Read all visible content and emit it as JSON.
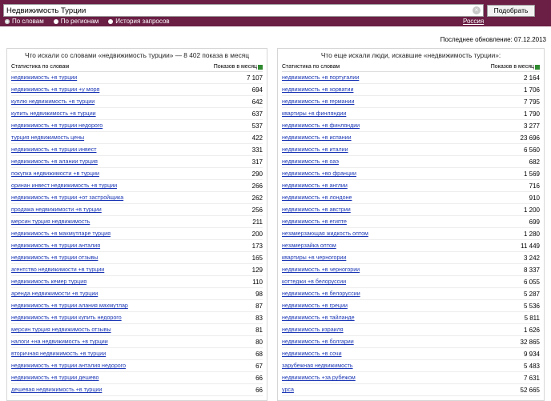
{
  "search": {
    "query": "Недвижимость Турции",
    "submit_label": "Подобрать",
    "clear_icon": "×"
  },
  "tabs": [
    {
      "label": "По словам",
      "active": true
    },
    {
      "label": "По регионам",
      "active": false
    },
    {
      "label": "История запросов",
      "active": false
    }
  ],
  "region": "Россия",
  "last_update": "Последнее обновление: 07.12.2013",
  "left": {
    "title": "Что искали со словами «недвижимость турции» — 8 402 показа в месяц",
    "col_words": "Статистика по словам",
    "col_impressions": "Показов в месяц",
    "rows": [
      {
        "phrase": "недвижимость +в турции",
        "count": "7 107"
      },
      {
        "phrase": "недвижимость +в турции +у моря",
        "count": "694"
      },
      {
        "phrase": "куплю недвижимость +в турции",
        "count": "642"
      },
      {
        "phrase": "купить недвижимость +в турции",
        "count": "637"
      },
      {
        "phrase": "недвижимость +в турции недорого",
        "count": "537"
      },
      {
        "phrase": "турция недвижимость цены",
        "count": "422"
      },
      {
        "phrase": "недвижимость +в турции инвест",
        "count": "331"
      },
      {
        "phrase": "недвижимость +в алании турция",
        "count": "317"
      },
      {
        "phrase": "покупка недвижимости +в турции",
        "count": "290"
      },
      {
        "phrase": "оринан инвест недвижимость +в турции",
        "count": "266"
      },
      {
        "phrase": "недвижимость +в турции +от застройщика",
        "count": "262"
      },
      {
        "phrase": "продажа недвижимости +в турции",
        "count": "256"
      },
      {
        "phrase": "мерсин турция недвижимость",
        "count": "211"
      },
      {
        "phrase": "недвижимость +в махмутларе турция",
        "count": "200"
      },
      {
        "phrase": "недвижимость +в турции анталия",
        "count": "173"
      },
      {
        "phrase": "недвижимость +в турции отзывы",
        "count": "165"
      },
      {
        "phrase": "агентство недвижимости +в турции",
        "count": "129"
      },
      {
        "phrase": "недвижимость кемер турция",
        "count": "110"
      },
      {
        "phrase": "аренда недвижимости +в турции",
        "count": "98"
      },
      {
        "phrase": "недвижимость +в турции алания махмутлар",
        "count": "87"
      },
      {
        "phrase": "недвижимость +в турции купить недорого",
        "count": "83"
      },
      {
        "phrase": "мерсин турция недвижимость отзывы",
        "count": "81"
      },
      {
        "phrase": "налоги +на недвижимость +в турции",
        "count": "80"
      },
      {
        "phrase": "вторичная недвижимость +в турции",
        "count": "68"
      },
      {
        "phrase": "недвижимость +в турции анталия недорого",
        "count": "67"
      },
      {
        "phrase": "недвижимость +в турции дешево",
        "count": "66"
      },
      {
        "phrase": "дешевая недвижимость +в турции",
        "count": "66"
      }
    ]
  },
  "right": {
    "title": "Что еще искали люди, искавшие «недвижимость турции»:",
    "col_words": "Статистика по словам",
    "col_impressions": "Показов в месяц",
    "rows": [
      {
        "phrase": "недвижимость +в португалии",
        "count": "2 164"
      },
      {
        "phrase": "недвижимость +в хорватии",
        "count": "1 706"
      },
      {
        "phrase": "недвижимость +в германии",
        "count": "7 795"
      },
      {
        "phrase": "квартиры +в финляндии",
        "count": "1 790"
      },
      {
        "phrase": "недвижимость +в финляндии",
        "count": "3 277"
      },
      {
        "phrase": "недвижимость +в испании",
        "count": "23 696"
      },
      {
        "phrase": "недвижимость +в италии",
        "count": "6 560"
      },
      {
        "phrase": "недвижимость +в оаэ",
        "count": "682"
      },
      {
        "phrase": "недвижимость +во франции",
        "count": "1 569"
      },
      {
        "phrase": "недвижимость +в англии",
        "count": "716"
      },
      {
        "phrase": "недвижимость +в лондоне",
        "count": "910"
      },
      {
        "phrase": "недвижимость +в австрии",
        "count": "1 200"
      },
      {
        "phrase": "недвижимость +в египте",
        "count": "699"
      },
      {
        "phrase": "незамерзающая жидкость оптом",
        "count": "1 280"
      },
      {
        "phrase": "незамерзайка оптом",
        "count": "11 449"
      },
      {
        "phrase": "квартиры +в черногории",
        "count": "3 242"
      },
      {
        "phrase": "недвижимость +в черногории",
        "count": "8 337"
      },
      {
        "phrase": "коттеджи +в белоруссии",
        "count": "6 055"
      },
      {
        "phrase": "недвижимость +в белоруссии",
        "count": "5 287"
      },
      {
        "phrase": "недвижимость +в греции",
        "count": "5 536"
      },
      {
        "phrase": "недвижимость +в тайланде",
        "count": "5 811"
      },
      {
        "phrase": "недвижимость израиля",
        "count": "1 626"
      },
      {
        "phrase": "недвижимость +в болгарии",
        "count": "32 865"
      },
      {
        "phrase": "недвижимость +в сочи",
        "count": "9 934"
      },
      {
        "phrase": "зарубежная недвижимость",
        "count": "5 483"
      },
      {
        "phrase": "недвижимость +за рубежом",
        "count": "7 631"
      },
      {
        "phrase": "урса",
        "count": "52 665"
      }
    ]
  }
}
